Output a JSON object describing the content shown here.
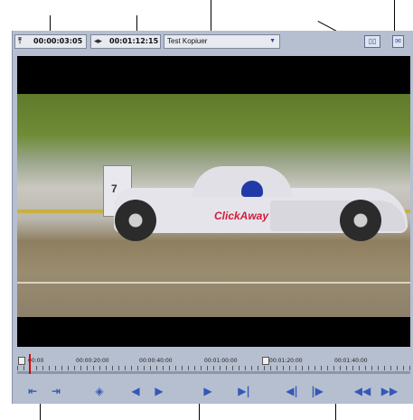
{
  "toolbar": {
    "in_timecode": "00:00:03:05",
    "duration_timecode": "00:01:12:15",
    "source_dropdown": "Test Kopiuer"
  },
  "timeline": {
    "ruler_labels": [
      "00:00",
      "00:00:20:00",
      "00:00:40:00",
      "00:01:00:00",
      "00:01:20:00",
      "00:01:40:00"
    ],
    "playhead_position_fraction": 0.03
  },
  "video": {
    "sponsor_text": "ClickAway",
    "car_number": "7"
  },
  "icons": {
    "in_point": "up-arrow-icon",
    "duration": "duration-arrows-icon",
    "dropdown_arrow": "chevron-down-icon",
    "split_view": "dual-screen-icon",
    "export": "export-icon"
  },
  "colors": {
    "panel": "#b6bfcf",
    "accent": "#3557b8",
    "playhead": "#d40000"
  }
}
